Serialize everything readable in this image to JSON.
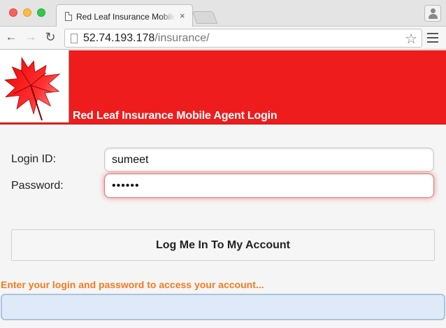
{
  "browser": {
    "tab": {
      "title": "Red Leaf Insurance Mobile Agent Login",
      "close_label": "×"
    },
    "address": {
      "host": "52.74.193.178",
      "path": "/insurance/"
    },
    "icons": {
      "back": "back-arrow-icon",
      "forward": "forward-arrow-icon",
      "reload": "reload-icon",
      "bookmark": "star-icon",
      "menu": "hamburger-menu-icon",
      "profile": "person-icon"
    }
  },
  "header": {
    "title": "Red Leaf Insurance Mobile Agent Login",
    "logo": "red-maple-leaf-logo",
    "bg_color": "#ee1c1c"
  },
  "form": {
    "login_label": "Login ID:",
    "login_value": "sumeet",
    "password_label": "Password:",
    "password_value": "••••••",
    "submit_label": "Log Me In To My Account"
  },
  "message": {
    "text": "Enter your login and password to access your account...",
    "color": "#f47b20"
  },
  "status_box": {
    "value": ""
  }
}
